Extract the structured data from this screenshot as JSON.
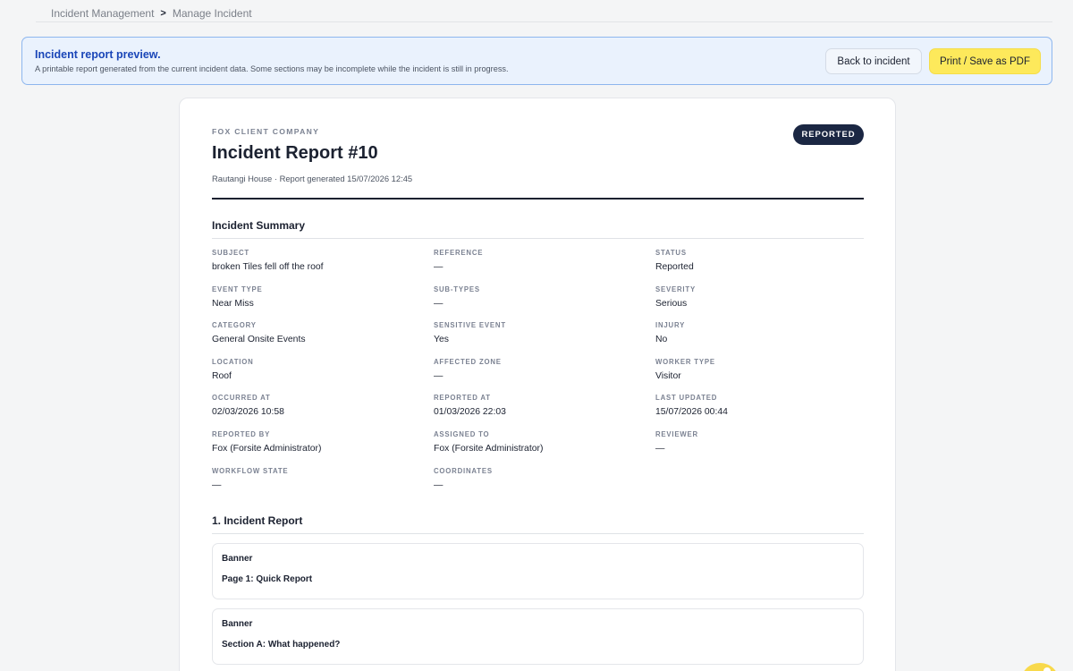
{
  "breadcrumb": {
    "root": "Incident Management",
    "separator": ">",
    "current": "Manage Incident"
  },
  "banner": {
    "title": "Incident report preview.",
    "text": "A printable report generated from the current incident data. Some sections may be incomplete while the incident is still in progress.",
    "back_label": "Back to incident",
    "print_label": "Print / Save as PDF"
  },
  "report": {
    "company": "FOX CLIENT COMPANY",
    "title": "Incident Report #10",
    "subtitle": "Rautangi House · Report generated 15/07/2026 12:45",
    "status": "REPORTED",
    "summary_title": "Incident Summary",
    "fields": [
      {
        "label": "SUBJECT",
        "value": "broken Tiles fell off the roof"
      },
      {
        "label": "REFERENCE",
        "value": "—"
      },
      {
        "label": "STATUS",
        "value": "Reported"
      },
      {
        "label": "EVENT TYPE",
        "value": "Near Miss"
      },
      {
        "label": "SUB-TYPES",
        "value": "—"
      },
      {
        "label": "SEVERITY",
        "value": "Serious"
      },
      {
        "label": "CATEGORY",
        "value": "General Onsite Events"
      },
      {
        "label": "SENSITIVE EVENT",
        "value": "Yes"
      },
      {
        "label": "INJURY",
        "value": "No"
      },
      {
        "label": "LOCATION",
        "value": "Roof"
      },
      {
        "label": "AFFECTED ZONE",
        "value": "—"
      },
      {
        "label": "WORKER TYPE",
        "value": "Visitor"
      },
      {
        "label": "OCCURRED AT",
        "value": "02/03/2026 10:58"
      },
      {
        "label": "REPORTED AT",
        "value": "01/03/2026 22:03"
      },
      {
        "label": "LAST UPDATED",
        "value": "15/07/2026 00:44"
      },
      {
        "label": "REPORTED BY",
        "value": "Fox (Forsite Administrator)"
      },
      {
        "label": "ASSIGNED TO",
        "value": "Fox (Forsite Administrator)"
      },
      {
        "label": "REVIEWER",
        "value": "—"
      },
      {
        "label": "WORKFLOW STATE",
        "value": "—"
      },
      {
        "label": "COORDINATES",
        "value": "—"
      }
    ],
    "section1_title": "1. Incident Report",
    "cards": [
      {
        "label": "Banner",
        "text": "Page 1: Quick Report"
      },
      {
        "label": "Banner",
        "text": "Section A: What happened?"
      }
    ]
  },
  "colors": {
    "accent_blue": "#1a46b8",
    "banner_bg": "#eaf2fd",
    "print_button": "#fde95b",
    "status_pill": "#1b2743"
  }
}
